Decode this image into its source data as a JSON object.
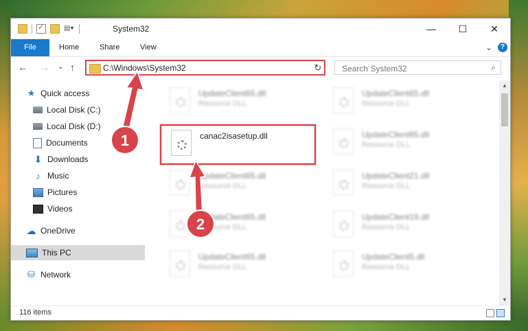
{
  "window": {
    "title": "System32",
    "controls": {
      "minimize": "—",
      "maximize": "☐",
      "close": "✕"
    }
  },
  "ribbon": {
    "tabs": [
      "File",
      "Home",
      "Share",
      "View"
    ],
    "expand": "⌄",
    "help": "?"
  },
  "nav": {
    "back": "←",
    "forward": "→",
    "recent": "⌄",
    "up": "↑",
    "address": "C:\\Windows\\System32",
    "address_dropdown": "⌄",
    "refresh": "↻",
    "search_placeholder": "Search System32",
    "search_icon": "⌕"
  },
  "sidebar": {
    "items": [
      {
        "label": "Quick access",
        "icon": "star-icon",
        "pinned": false
      },
      {
        "label": "Local Disk (C:)",
        "icon": "disk-icon",
        "pinned": true
      },
      {
        "label": "Local Disk (D:)",
        "icon": "disk-icon",
        "pinned": true
      },
      {
        "label": "Documents",
        "icon": "documents-icon",
        "pinned": true
      },
      {
        "label": "Downloads",
        "icon": "download-icon",
        "pinned": true
      },
      {
        "label": "Music",
        "icon": "music-icon",
        "pinned": true
      },
      {
        "label": "Pictures",
        "icon": "pictures-icon",
        "pinned": true
      },
      {
        "label": "Videos",
        "icon": "videos-icon",
        "pinned": true
      },
      {
        "label": "OneDrive",
        "icon": "cloud-icon",
        "pinned": false
      },
      {
        "label": "This PC",
        "icon": "pc-icon",
        "pinned": false
      },
      {
        "label": "Network",
        "icon": "network-icon",
        "pinned": false
      }
    ],
    "pin_glyph": "📌"
  },
  "files": {
    "left": [
      {
        "name": "UpdateClient65.dll",
        "type": "Resource DLL"
      },
      {
        "name": "canac2isasetup.dll",
        "type": ""
      },
      {
        "name": "UpdateClient65.dll",
        "type": "Resource DLL"
      },
      {
        "name": "UpdateClient65.dll",
        "type": "Resource DLL"
      },
      {
        "name": "UpdateClient65.dll",
        "type": "Resource DLL"
      }
    ],
    "right": [
      {
        "name": "UpdateClient65.dll",
        "type": "Resource DLL"
      },
      {
        "name": "UpdateClient65.dll",
        "type": "Resource DLL"
      },
      {
        "name": "UpdateClient21.dll",
        "type": "Resource DLL"
      },
      {
        "name": "UpdateClient19.dll",
        "type": "Resource DLL"
      },
      {
        "name": "UpdateClient5.dll",
        "type": "Resource DLL"
      }
    ]
  },
  "status": {
    "item_count": "116 items"
  },
  "annotations": {
    "step1": "1",
    "step2": "2",
    "color": "#d9434a"
  }
}
